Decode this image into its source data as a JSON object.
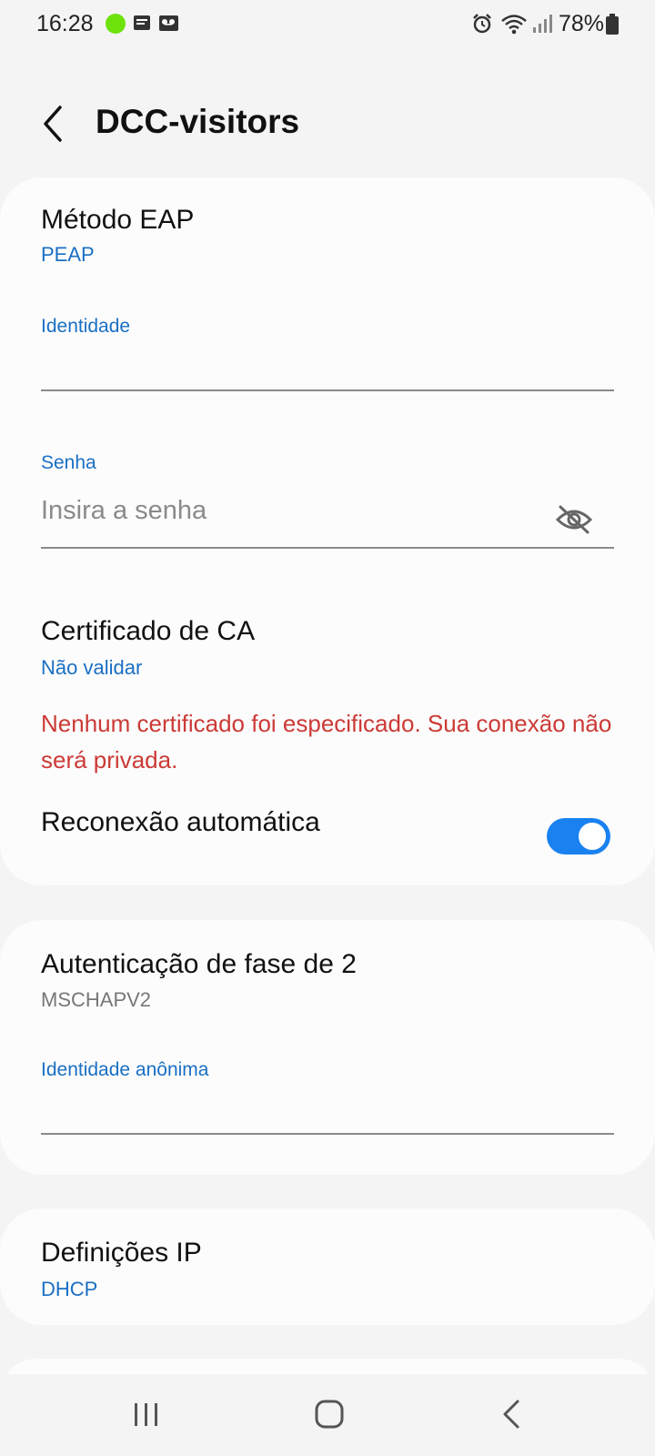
{
  "status_bar": {
    "time": "16:28",
    "battery": "78%",
    "icons": [
      "message-icon",
      "voicemail-icon",
      "alarm-icon",
      "wifi-icon",
      "signal-icon",
      "battery-icon"
    ]
  },
  "header": {
    "title": "DCC-visitors"
  },
  "eap_card": {
    "eap_method_title": "Método EAP",
    "eap_method_value": "PEAP",
    "identity_label": "Identidade",
    "identity_value": "",
    "password_label": "Senha",
    "password_placeholder": "Insira a senha",
    "ca_cert_title": "Certificado de CA",
    "ca_cert_value": "Não validar",
    "warning": "Nenhum certificado foi especificado. Sua conexão não será privada.",
    "auto_reconnect_label": "Reconexão automática",
    "auto_reconnect_on": true
  },
  "phase2_card": {
    "title": "Autenticação de fase de 2",
    "value": "MSCHAPV2",
    "anon_identity_label": "Identidade anônima",
    "anon_identity_value": ""
  },
  "ip_card": {
    "title": "Definições IP",
    "value": "DHCP"
  },
  "colors": {
    "accent": "#1a6fc4",
    "toggle_on": "#1a82f0",
    "warning": "#cc3a36",
    "status_dot": "#6ee20b"
  }
}
